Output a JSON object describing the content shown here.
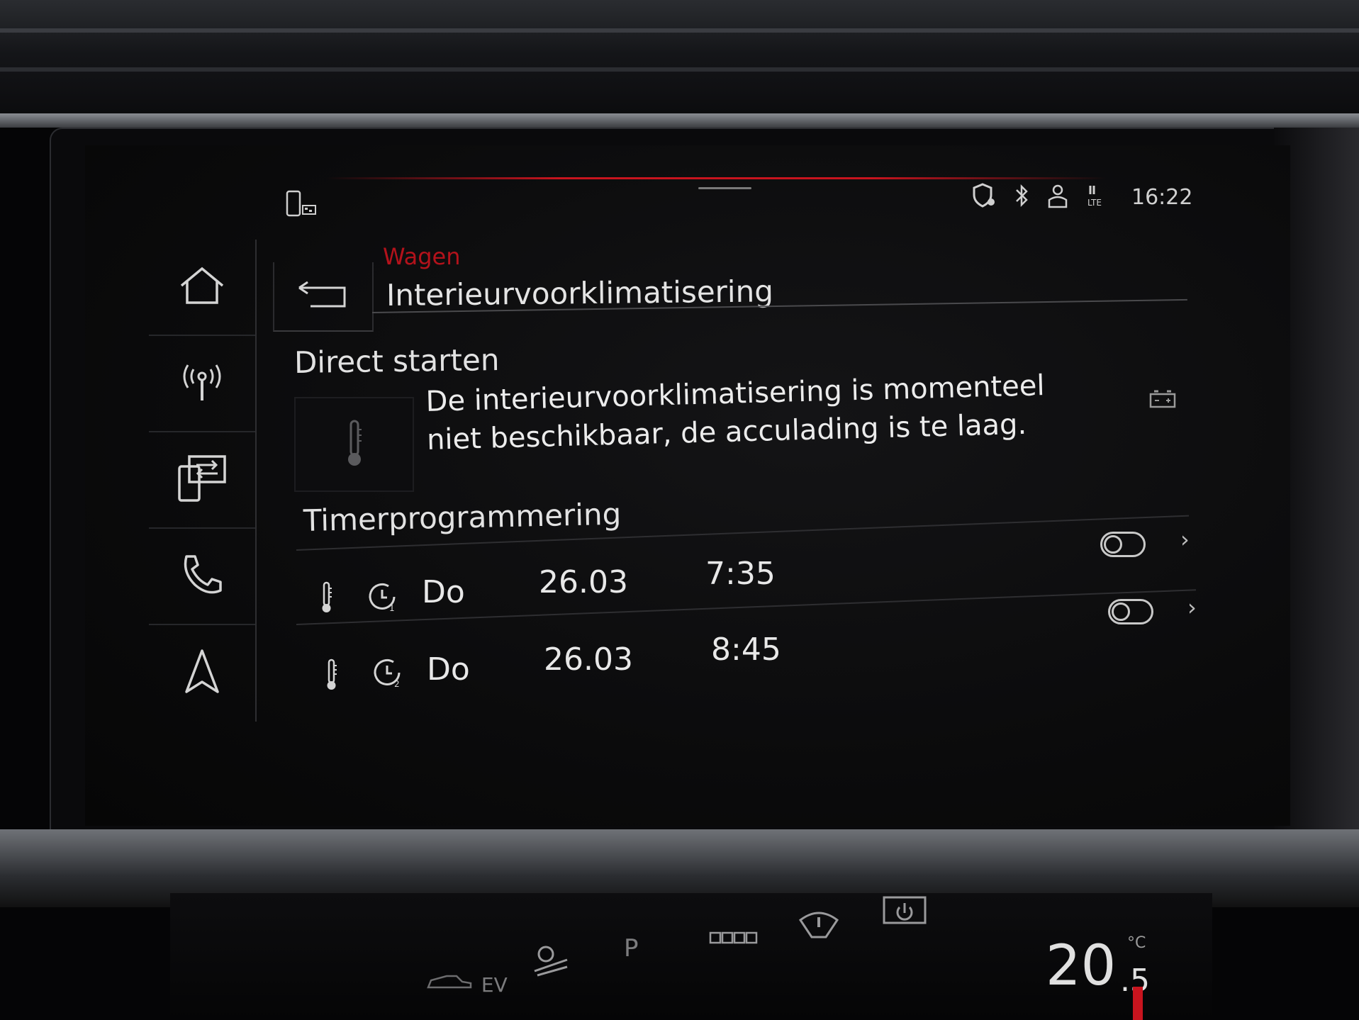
{
  "status_bar": {
    "time": "16:22",
    "icons": [
      "phone-connect-icon",
      "shield-location-icon",
      "bluetooth-icon",
      "user-icon",
      "lte-icon"
    ]
  },
  "sidebar": {
    "items": [
      {
        "name": "home",
        "icon": "home-icon"
      },
      {
        "name": "radio",
        "icon": "radio-antenna-icon"
      },
      {
        "name": "media",
        "icon": "phone-transfer-icon"
      },
      {
        "name": "phone",
        "icon": "phone-handset-icon"
      },
      {
        "name": "navigation",
        "icon": "navigation-arrow-icon"
      }
    ]
  },
  "header": {
    "breadcrumb": "Wagen",
    "title": "Interieurvoorklimatisering",
    "back_icon": "back-arrow-icon"
  },
  "direct_start": {
    "heading": "Direct starten",
    "message": "De interieurvoorklimatisering is momenteel niet beschikbaar, de acculading is te laag."
  },
  "timer": {
    "heading": "Timerprogrammering",
    "rows": [
      {
        "timer_no": "1",
        "day": "Do",
        "date": "26.03",
        "time": "7:35",
        "enabled": false
      },
      {
        "timer_no": "2",
        "day": "Do",
        "date": "26.03",
        "time": "8:45",
        "enabled": false
      }
    ]
  },
  "climate_bar": {
    "ev_label": "EV",
    "park_label": "P",
    "temperature": "20",
    "temperature_decimal": ".5",
    "temperature_unit": "°C"
  },
  "colors": {
    "accent_red": "#c8141e",
    "breadcrumb_red": "#b3121b",
    "text": "#e6e6e6"
  }
}
